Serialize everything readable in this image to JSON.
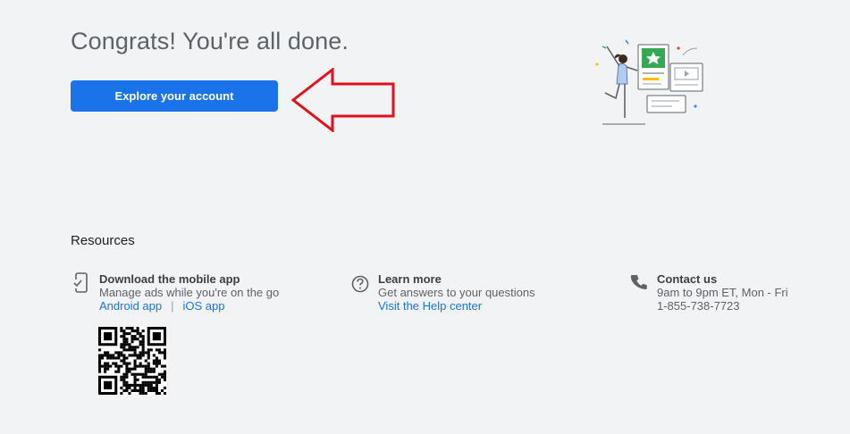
{
  "main": {
    "title": "Congrats! You're all done.",
    "explore_label": "Explore your account"
  },
  "resources": {
    "title": "Resources",
    "mobile": {
      "heading": "Download the mobile app",
      "description": "Manage ads while you're on the go",
      "android_label": "Android app",
      "separator": "|",
      "ios_label": "iOS app",
      "icon": "phone-check-icon"
    },
    "learn": {
      "heading": "Learn more",
      "description": "Get answers to your questions",
      "link_label": "Visit the Help center",
      "icon": "help-circle-icon"
    },
    "contact": {
      "heading": "Contact us",
      "hours": "9am to 9pm ET, Mon - Fri",
      "phone": "1-855-738-7723",
      "icon": "phone-icon"
    }
  },
  "colors": {
    "accent": "#1a73e8",
    "background": "#f1f3f4",
    "annotation_arrow": "#e0121e"
  }
}
